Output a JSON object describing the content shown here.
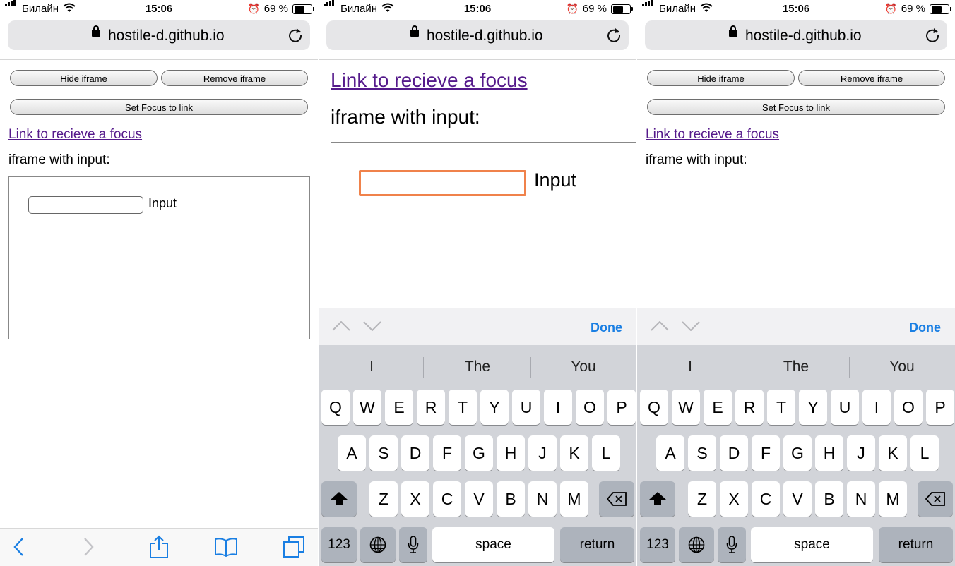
{
  "status_bar": {
    "carrier": "Билайн",
    "time": "15:06",
    "battery_percent": "69 %",
    "battery_level": 0.69,
    "alarm_icon": "alarm-clock-icon",
    "wifi_icon": "wifi-icon",
    "signal_icon": "signal-bars-icon"
  },
  "url_bar": {
    "url": "hostile-d.github.io",
    "lock_icon": "lock-icon",
    "reload_icon": "reload-icon"
  },
  "page": {
    "hide_iframe": "Hide iframe",
    "remove_iframe": "Remove iframe",
    "set_focus": "Set Focus to link",
    "focus_link": "Link to recieve a focus",
    "iframe_label": "iframe with input:",
    "input_label": "Input"
  },
  "toolbar": {
    "icons": [
      "back-icon",
      "forward-icon",
      "share-icon",
      "bookmarks-icon",
      "tabs-icon"
    ]
  },
  "keyboard": {
    "done": "Done",
    "suggestions": [
      "I",
      "The",
      "You"
    ],
    "row1": [
      "Q",
      "W",
      "E",
      "R",
      "T",
      "Y",
      "U",
      "I",
      "O",
      "P"
    ],
    "row2": [
      "A",
      "S",
      "D",
      "F",
      "G",
      "H",
      "J",
      "K",
      "L"
    ],
    "row3": [
      "Z",
      "X",
      "C",
      "V",
      "B",
      "N",
      "M"
    ],
    "numbers": "123",
    "space": "space",
    "return": "return"
  },
  "colors": {
    "link": "#551a8b",
    "done": "#1a7fe3",
    "focus_ring": "#f0824b",
    "keyboard_bg": "#d2d4d9"
  }
}
